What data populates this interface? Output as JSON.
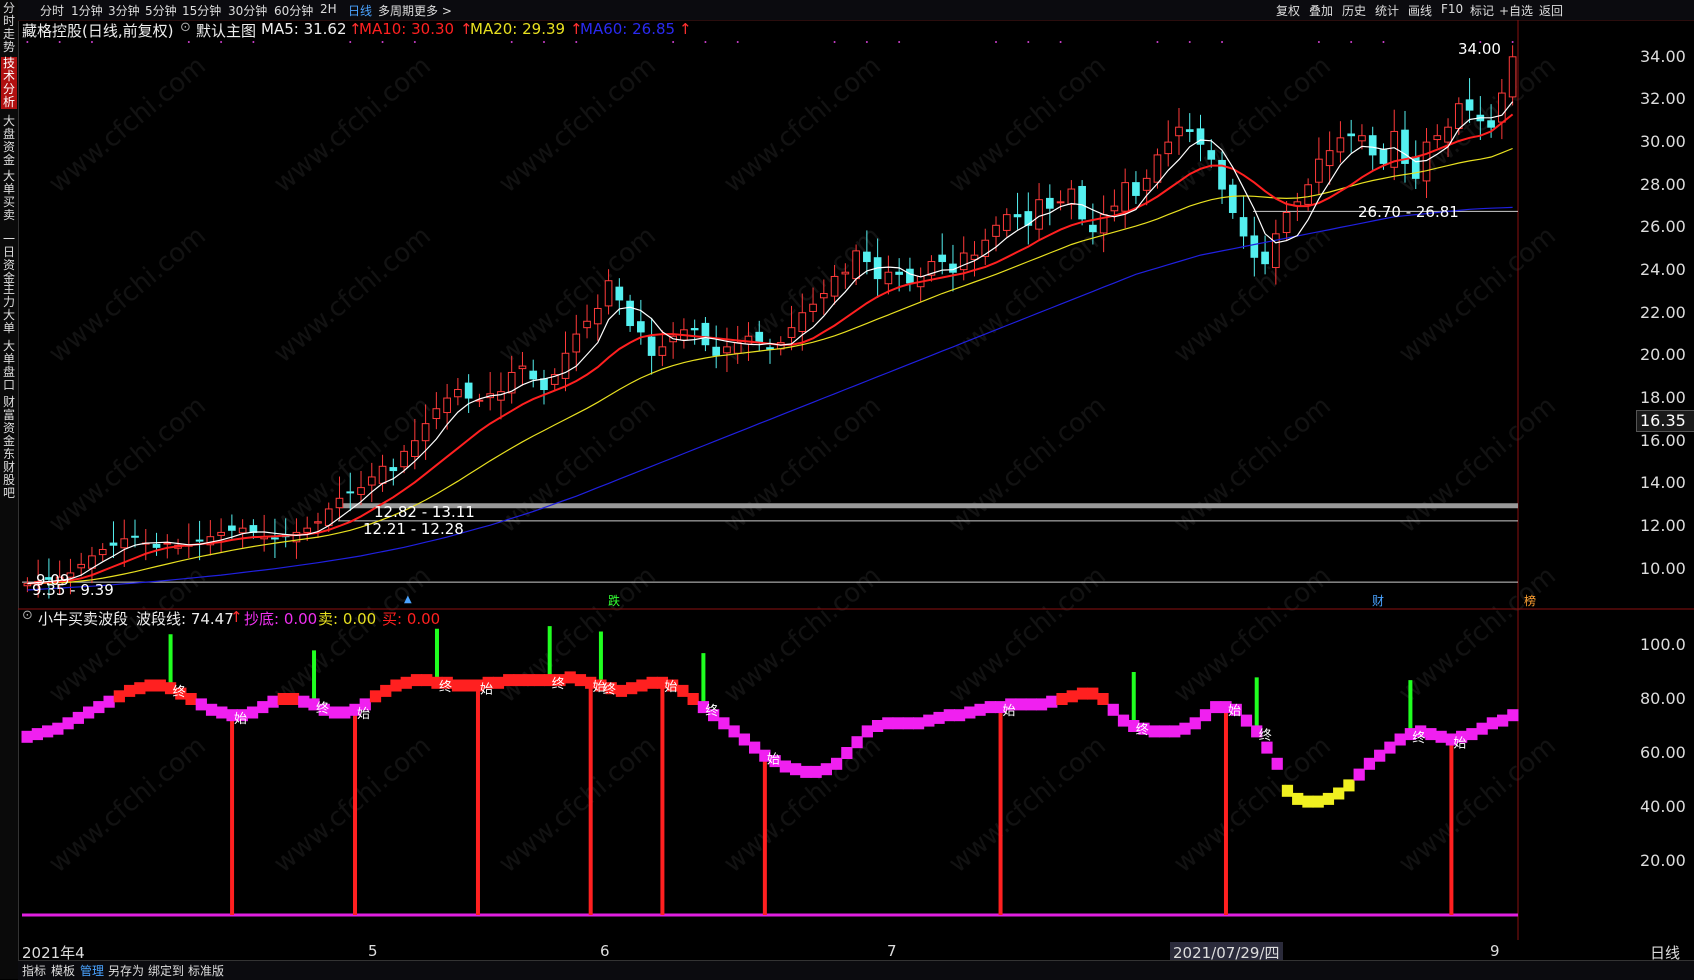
{
  "topbar": {
    "periods": [
      "分时",
      "1分钟",
      "3分钟",
      "5分钟",
      "15分钟",
      "30分钟",
      "60分钟",
      "2H",
      "日线",
      "多周期",
      "更多 >"
    ],
    "active_index": 8,
    "right_tools": [
      "复权",
      "叠加",
      "历史",
      "统计",
      "画线",
      "F10",
      "标记",
      "+自选",
      "返回"
    ]
  },
  "leftnav": {
    "tabs": [
      "分时走势",
      "技术分析",
      "大盘资金",
      "大单买卖",
      "一日资金",
      "主力大单",
      "大单盘口",
      "财富资金",
      "东财股吧"
    ],
    "active_index": 1
  },
  "main_legend": {
    "stock": "藏格控股(日线,前复权)",
    "indicator": "默认主图",
    "ma5": "MA5: 31.62",
    "ma10": "MA10: 30.30",
    "ma20": "MA20: 29.39",
    "ma60": "MA60: 26.85",
    "arrow": "↑"
  },
  "sub_legend": {
    "name": "小牛买卖波段",
    "line": "波段线: 74.47",
    "chaodi": "抄底: 0.00",
    "mai_sell": "卖: 0.00",
    "mai_buy": "买: 0.00",
    "arrow": "↑"
  },
  "price_axis": [
    "34.00",
    "32.00",
    "30.00",
    "28.00",
    "26.00",
    "24.00",
    "22.00",
    "20.00",
    "18.00",
    "16.00",
    "14.00",
    "12.00",
    "10.00"
  ],
  "current_price": "16.35",
  "osc_axis": [
    "100.0",
    "80.00",
    "60.00",
    "40.00",
    "20.00"
  ],
  "annotations": {
    "high": "34.00",
    "range1": "26.70 - 26.81",
    "range2": "12.82 - 13.11",
    "range3": "12.21 - 12.28",
    "low": "9.09",
    "range4": "9.35 - 9.39"
  },
  "event_tags": [
    "跌",
    "财",
    "榜"
  ],
  "osc_marks": {
    "start": "始",
    "end": "终"
  },
  "x_axis": [
    "2021年4",
    "5",
    "6",
    "7",
    "2021/07/29/四",
    "9"
  ],
  "period_label": "日线",
  "bottombar": [
    "指标",
    "模板",
    "管理",
    "另存为",
    "绑定到",
    "标准版"
  ],
  "bottom_active_index": 2,
  "chart_data": {
    "type": "candlestick",
    "title": "藏格控股(日线,前复权)",
    "ylim": [
      9,
      34.6
    ],
    "close": [
      9.3,
      9.4,
      9.5,
      9.6,
      9.8,
      10.2,
      10.6,
      10.9,
      11.1,
      11.4,
      11.5,
      11.2,
      11.0,
      11.2,
      11.1,
      11.1,
      11.3,
      11.5,
      11.7,
      11.8,
      11.9,
      11.7,
      11.5,
      11.4,
      11.5,
      11.7,
      11.9,
      12.2,
      12.8,
      13.3,
      13.6,
      13.8,
      14.3,
      14.8,
      14.6,
      15.5,
      16.0,
      16.8,
      17.5,
      18.0,
      18.4,
      18.0,
      17.9,
      18.2,
      18.3,
      19.2,
      19.5,
      18.9,
      18.4,
      19.1,
      20.1,
      21.0,
      21.6,
      22.2,
      23.5,
      22.6,
      21.4,
      21.1,
      20.0,
      20.4,
      20.9,
      21.2,
      21.2,
      20.5,
      20.0,
      20.4,
      20.6,
      20.9,
      20.6,
      20.3,
      20.6,
      21.3,
      22.0,
      22.4,
      22.9,
      23.7,
      23.9,
      24.9,
      24.4,
      23.6,
      23.9,
      23.8,
      23.4,
      23.7,
      24.4,
      24.4,
      23.9,
      24.8,
      24.7,
      25.4,
      26.1,
      26.6,
      26.5,
      26.1,
      27.3,
      26.9,
      27.2,
      27.8,
      26.4,
      25.8,
      26.6,
      27.0,
      28.1,
      27.5,
      28.3,
      29.4,
      30.0,
      30.7,
      30.5,
      29.9,
      29.2,
      27.8,
      26.7,
      25.6,
      24.6,
      24.3,
      25.7,
      26.7,
      27.2,
      28.0,
      29.2,
      29.6,
      30.2,
      30.3,
      30.3,
      29.4,
      29.0,
      30.5,
      29.0,
      28.3,
      30.0,
      30.3,
      30.7,
      31.8,
      31.5,
      31.0,
      30.7,
      32.3,
      34.0
    ],
    "ma": {
      "MA5": [
        9.3,
        9.35,
        9.4,
        9.45,
        9.52,
        9.7,
        10.02,
        10.32,
        10.6,
        10.9,
        11.1,
        11.2,
        11.22,
        11.24,
        11.18,
        11.12,
        11.14,
        11.24,
        11.34,
        11.48,
        11.64,
        11.72,
        11.72,
        11.66,
        11.6,
        11.56,
        11.6,
        11.74,
        12.02,
        12.38,
        12.76,
        13.14,
        13.6,
        14.0,
        14.22,
        14.6,
        15.04,
        15.54,
        16.08,
        16.76,
        17.34,
        17.74,
        17.96,
        18.1,
        18.16,
        18.32,
        18.62,
        18.82,
        18.9,
        19.02,
        19.2,
        19.5,
        20.04,
        20.6,
        21.68,
        22.18,
        22.26,
        22.1,
        21.72,
        21.1,
        20.78,
        20.7,
        20.74,
        20.84,
        20.76,
        20.66,
        20.58,
        20.52,
        20.5,
        20.56,
        20.48,
        20.54,
        20.96,
        21.32,
        21.84,
        22.46,
        22.98,
        23.58,
        23.96,
        24.1,
        24.14,
        24.1,
        23.82,
        23.68,
        23.84,
        24.0,
        24.02,
        24.24,
        24.44,
        24.74,
        25.08,
        25.52,
        25.86,
        26.14,
        26.52,
        26.68,
        26.98,
        27.12,
        27.06,
        26.82,
        26.6,
        26.5,
        26.62,
        26.84,
        27.5,
        28.06,
        28.68,
        29.18,
        29.78,
        30.1,
        30.06,
        29.62,
        28.82,
        27.84,
        26.86,
        25.7,
        25.28,
        25.38,
        25.62,
        26.36,
        27.34,
        28.14,
        28.94,
        29.46,
        29.8,
        29.76,
        29.66,
        29.74,
        29.44,
        29.08,
        29.14,
        29.44,
        29.78,
        30.62,
        31.06,
        31.14,
        31.14,
        31.26,
        31.9
      ],
      "MA10": [
        9.3,
        9.33,
        9.36,
        9.4,
        9.45,
        9.55,
        9.7,
        9.9,
        10.1,
        10.3,
        10.5,
        10.7,
        10.85,
        10.98,
        11.05,
        11.1,
        11.15,
        11.2,
        11.25,
        11.35,
        11.42,
        11.48,
        11.5,
        11.52,
        11.55,
        11.58,
        11.62,
        11.68,
        11.82,
        12.0,
        12.2,
        12.45,
        12.75,
        13.05,
        13.35,
        13.7,
        14.05,
        14.45,
        14.85,
        15.25,
        15.65,
        16.05,
        16.45,
        16.8,
        17.1,
        17.4,
        17.7,
        17.95,
        18.15,
        18.35,
        18.55,
        18.8,
        19.1,
        19.45,
        19.9,
        20.3,
        20.6,
        20.85,
        20.95,
        21.0,
        21.0,
        20.95,
        20.9,
        20.85,
        20.8,
        20.75,
        20.7,
        20.65,
        20.6,
        20.55,
        20.5,
        20.5,
        20.6,
        20.8,
        21.1,
        21.4,
        21.75,
        22.1,
        22.45,
        22.75,
        23.0,
        23.2,
        23.35,
        23.45,
        23.55,
        23.65,
        23.75,
        23.85,
        24.0,
        24.15,
        24.35,
        24.6,
        24.85,
        25.1,
        25.4,
        25.65,
        25.9,
        26.1,
        26.25,
        26.35,
        26.45,
        26.55,
        26.7,
        26.9,
        27.15,
        27.45,
        27.8,
        28.15,
        28.5,
        28.75,
        28.9,
        28.9,
        28.75,
        28.45,
        28.1,
        27.7,
        27.35,
        27.1,
        27.0,
        27.0,
        27.15,
        27.4,
        27.7,
        28.0,
        28.35,
        28.65,
        28.9,
        29.1,
        29.2,
        29.3,
        29.45,
        29.65,
        29.85,
        30.05,
        30.2,
        30.3,
        30.5,
        30.9,
        31.3
      ],
      "MA20": [
        9.3,
        9.31,
        9.32,
        9.34,
        9.37,
        9.42,
        9.48,
        9.56,
        9.65,
        9.75,
        9.86,
        9.98,
        10.1,
        10.22,
        10.34,
        10.45,
        10.56,
        10.66,
        10.76,
        10.86,
        10.95,
        11.04,
        11.12,
        11.2,
        11.27,
        11.34,
        11.41,
        11.48,
        11.57,
        11.68,
        11.8,
        11.95,
        12.12,
        12.3,
        12.5,
        12.72,
        12.96,
        13.22,
        13.5,
        13.8,
        14.1,
        14.42,
        14.74,
        15.06,
        15.36,
        15.66,
        15.95,
        16.22,
        16.48,
        16.74,
        17.0,
        17.26,
        17.52,
        17.8,
        18.1,
        18.4,
        18.68,
        18.94,
        19.16,
        19.36,
        19.52,
        19.66,
        19.78,
        19.88,
        19.96,
        20.02,
        20.08,
        20.14,
        20.2,
        20.26,
        20.32,
        20.4,
        20.5,
        20.62,
        20.76,
        20.92,
        21.1,
        21.3,
        21.5,
        21.7,
        21.9,
        22.1,
        22.3,
        22.5,
        22.7,
        22.9,
        23.08,
        23.26,
        23.44,
        23.62,
        23.8,
        24.0,
        24.2,
        24.4,
        24.6,
        24.8,
        25.0,
        25.2,
        25.36,
        25.5,
        25.64,
        25.78,
        25.92,
        26.06,
        26.22,
        26.4,
        26.6,
        26.8,
        27.0,
        27.16,
        27.3,
        27.4,
        27.46,
        27.48,
        27.46,
        27.42,
        27.38,
        27.36,
        27.38,
        27.44,
        27.54,
        27.66,
        27.8,
        27.94,
        28.08,
        28.2,
        28.3,
        28.4,
        28.48,
        28.56,
        28.66,
        28.78,
        28.9,
        29.02,
        29.12,
        29.2,
        29.3,
        29.5,
        29.7
      ],
      "MA60": [
        9.0,
        9.03,
        9.06,
        9.09,
        9.12,
        9.15,
        9.18,
        9.21,
        9.25,
        9.29,
        9.33,
        9.37,
        9.41,
        9.45,
        9.5,
        9.55,
        9.6,
        9.65,
        9.7,
        9.76,
        9.82,
        9.88,
        9.94,
        10.0,
        10.07,
        10.14,
        10.21,
        10.28,
        10.36,
        10.44,
        10.52,
        10.6,
        10.7,
        10.8,
        10.9,
        11.0,
        11.12,
        11.24,
        11.36,
        11.48,
        11.62,
        11.76,
        11.9,
        12.04,
        12.2,
        12.36,
        12.52,
        12.68,
        12.86,
        13.04,
        13.22,
        13.4,
        13.6,
        13.8,
        14.0,
        14.2,
        14.4,
        14.6,
        14.8,
        15.0,
        15.2,
        15.4,
        15.6,
        15.8,
        16.0,
        16.2,
        16.4,
        16.6,
        16.8,
        17.0,
        17.2,
        17.4,
        17.6,
        17.8,
        18.0,
        18.2,
        18.4,
        18.6,
        18.8,
        19.0,
        19.2,
        19.4,
        19.6,
        19.8,
        20.0,
        20.2,
        20.4,
        20.6,
        20.8,
        21.0,
        21.2,
        21.4,
        21.6,
        21.8,
        22.0,
        22.2,
        22.4,
        22.6,
        22.8,
        23.0,
        23.2,
        23.4,
        23.6,
        23.8,
        23.95,
        24.1,
        24.25,
        24.4,
        24.55,
        24.7,
        24.8,
        24.9,
        25.0,
        25.1,
        25.2,
        25.3,
        25.4,
        25.5,
        25.6,
        25.7,
        25.8,
        25.9,
        26.0,
        26.1,
        26.2,
        26.3,
        26.4,
        26.5,
        26.55,
        26.6,
        26.65,
        26.7,
        26.75,
        26.8,
        26.85,
        26.88,
        26.9,
        26.92,
        26.94
      ],
      "colors": {
        "MA5": "#ffffff",
        "MA10": "#ff2020",
        "MA20": "#e8e020",
        "MA60": "#2020e0"
      }
    },
    "oscillator": {
      "name": "波段线",
      "ylim": [
        0,
        110
      ],
      "values": [
        66,
        67,
        68,
        69,
        71,
        73,
        75,
        77,
        79,
        81,
        83,
        84,
        85,
        85,
        84,
        82,
        80,
        78,
        76,
        75,
        74,
        74,
        75,
        77,
        79,
        80,
        80,
        79,
        78,
        76,
        75,
        75,
        76,
        78,
        81,
        83,
        85,
        86,
        87,
        87,
        86,
        86,
        85,
        85,
        85,
        86,
        86,
        87,
        87,
        87,
        87,
        87,
        87,
        88,
        87,
        86,
        85,
        84,
        83,
        84,
        85,
        86,
        86,
        85,
        83,
        80,
        77,
        74,
        71,
        68,
        65,
        62,
        59,
        57,
        55,
        54,
        53,
        53,
        54,
        56,
        60,
        64,
        68,
        70,
        71,
        71,
        71,
        71,
        72,
        73,
        74,
        74,
        75,
        76,
        77,
        77,
        78,
        78,
        78,
        78,
        79,
        80,
        81,
        82,
        82,
        80,
        76,
        72,
        70,
        69,
        68,
        68,
        68,
        69,
        71,
        74,
        77,
        77,
        76,
        72,
        68,
        62,
        56,
        46,
        43,
        42,
        42,
        43,
        45,
        48,
        52,
        56,
        59,
        62,
        65,
        67,
        68,
        67,
        66,
        65,
        66,
        67,
        69,
        71,
        72,
        74
      ]
    }
  }
}
